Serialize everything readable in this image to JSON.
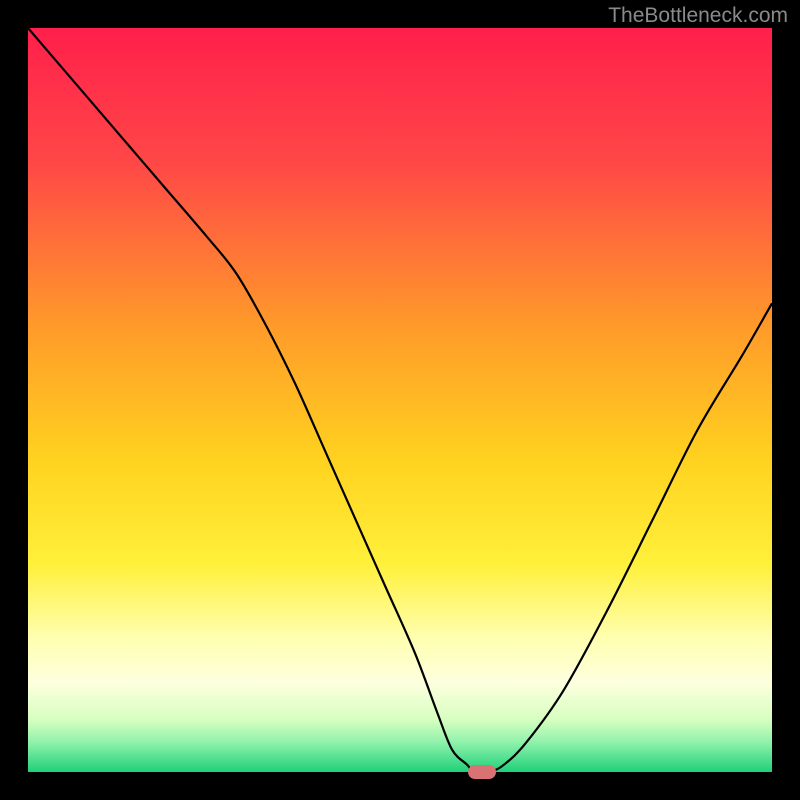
{
  "watermark": "TheBottleneck.com",
  "chart_data": {
    "type": "line",
    "title": "",
    "xlabel": "",
    "ylabel": "",
    "xlim": [
      0,
      100
    ],
    "ylim": [
      0,
      100
    ],
    "x": [
      0,
      6,
      12,
      18,
      24,
      28,
      32,
      36,
      40,
      44,
      48,
      52,
      55,
      57,
      59,
      60,
      62,
      64,
      67,
      72,
      78,
      84,
      90,
      96,
      100
    ],
    "values": [
      100,
      93,
      86,
      79,
      72,
      67,
      60,
      52,
      43,
      34,
      25,
      16,
      8,
      3,
      1,
      0,
      0,
      1,
      4,
      11,
      22,
      34,
      46,
      56,
      63
    ],
    "marker": {
      "x": 61,
      "y": 0,
      "color": "#d97272"
    },
    "gradient_stops": [
      {
        "pos": 0.0,
        "color": "#ff1f4b"
      },
      {
        "pos": 0.18,
        "color": "#ff4747"
      },
      {
        "pos": 0.4,
        "color": "#ff9a2a"
      },
      {
        "pos": 0.58,
        "color": "#ffd21f"
      },
      {
        "pos": 0.72,
        "color": "#fff03a"
      },
      {
        "pos": 0.82,
        "color": "#ffffb0"
      },
      {
        "pos": 0.88,
        "color": "#fdffde"
      },
      {
        "pos": 0.93,
        "color": "#d6ffc0"
      },
      {
        "pos": 0.96,
        "color": "#8ff2ab"
      },
      {
        "pos": 1.0,
        "color": "#1fd07a"
      }
    ]
  }
}
